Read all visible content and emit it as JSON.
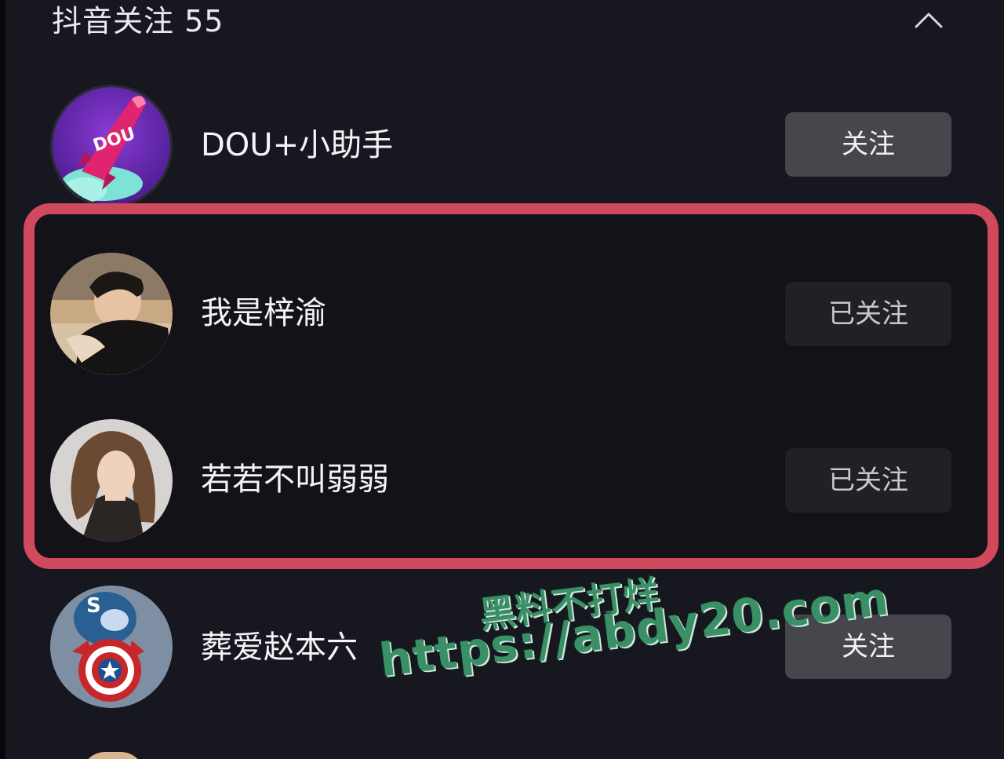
{
  "header": {
    "title": "抖音关注 55"
  },
  "following": [
    {
      "name": "DOU+小助手",
      "button": "关注",
      "state": "follow",
      "avatar_badge": "DOU"
    },
    {
      "name": "我是梓渝",
      "button": "已关注",
      "state": "followed"
    },
    {
      "name": "若若不叫弱弱",
      "button": "已关注",
      "state": "followed"
    },
    {
      "name": "葬爱赵本六",
      "button": "关注",
      "state": "follow",
      "avatar_badge": "S"
    }
  ],
  "watermark": {
    "line1": "黑料不打烊",
    "line2": "https://abdy20.com"
  },
  "colors": {
    "background": "#171720",
    "highlight_border": "#d1495d",
    "follow_button": "#46464d",
    "followed_button": "#202027",
    "watermark": "#3a8f66"
  },
  "icons": {
    "collapse": "chevron-up-icon"
  }
}
